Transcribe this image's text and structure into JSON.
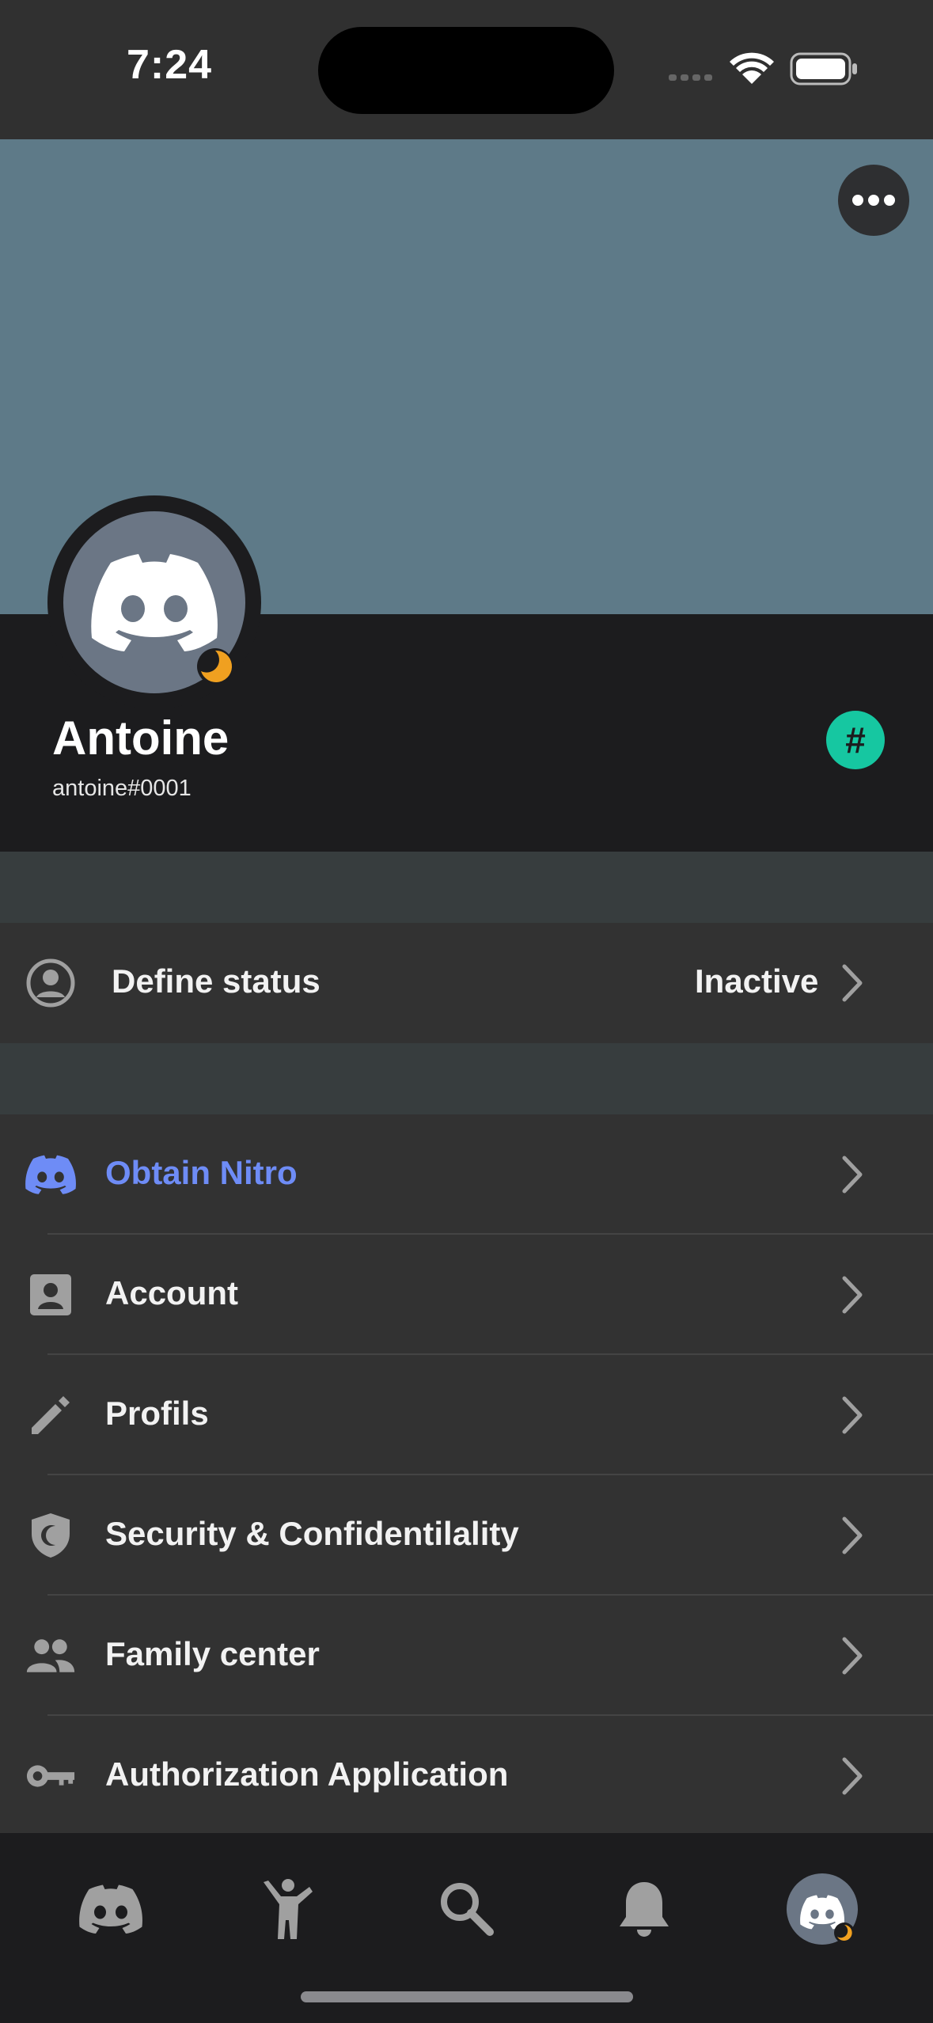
{
  "status_bar": {
    "time": "7:24"
  },
  "profile": {
    "display_name": "Antoine",
    "username": "antoine#0001",
    "badge_symbol": "#"
  },
  "status_row": {
    "label": "Define status",
    "value": "Inactive",
    "status_color": "#f0a020"
  },
  "menu": [
    {
      "label": "Obtain Nitro",
      "icon": "nitro-icon",
      "color": "#6e8cf6"
    },
    {
      "label": "Account",
      "icon": "account-icon"
    },
    {
      "label": "Profils",
      "icon": "pencil-icon"
    },
    {
      "label": "Security & Confidentilality",
      "icon": "shield-icon"
    },
    {
      "label": "Family center",
      "icon": "people-icon"
    },
    {
      "label": "Authorization Application",
      "icon": "key-icon"
    }
  ],
  "tabs": [
    "home-tab",
    "friends-tab",
    "search-tab",
    "notifications-tab",
    "profile-tab"
  ],
  "colors": {
    "banner": "#5e7a88",
    "accent_nitro": "#6e8cf6",
    "badge": "#16c7a1",
    "idle": "#f0a020"
  }
}
